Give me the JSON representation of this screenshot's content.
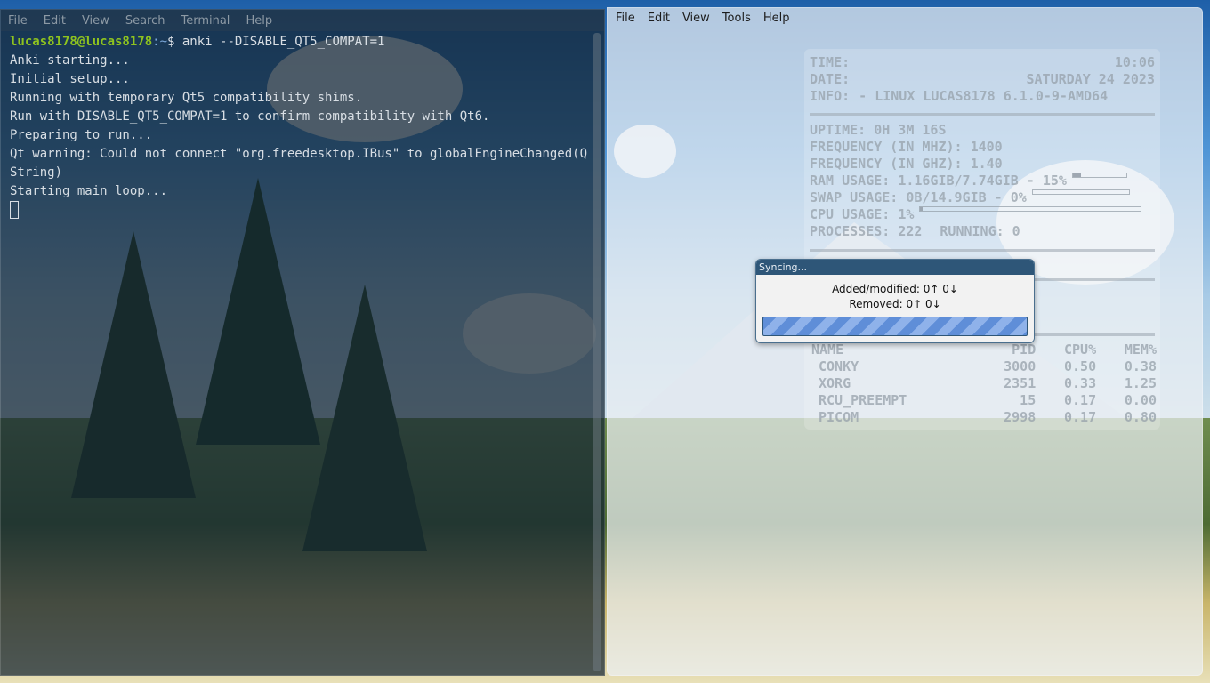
{
  "terminal": {
    "menu": [
      "File",
      "Edit",
      "View",
      "Search",
      "Terminal",
      "Help"
    ],
    "prompt_user": "lucas8178@lucas8178",
    "prompt_path": ":~",
    "prompt_command": "$ anki --DISABLE_QT5_COMPAT=1",
    "output": [
      "Anki starting...",
      "Initial setup...",
      "Running with temporary Qt5 compatibility shims.",
      "Run with DISABLE_QT5_COMPAT=1 to confirm compatibility with Qt6.",
      "Preparing to run...",
      "Qt warning: Could not connect \"org.freedesktop.IBus\" to globalEngineChanged(QString)",
      "Starting main loop..."
    ]
  },
  "anki": {
    "menu": [
      "File",
      "Edit",
      "View",
      "Tools",
      "Help"
    ]
  },
  "conky": {
    "time_label": "TIME:",
    "time_value": "10:06",
    "date_label": "DATE:",
    "date_value": "SATURDAY 24 2023",
    "info_label": "INFO:",
    "info_value": "- LINUX LUCAS8178 6.1.0-9-AMD64",
    "uptime_label": "UPTIME:",
    "uptime_value": "0H 3M 16S",
    "freq_mhz_label": "FREQUENCY (IN MHZ):",
    "freq_mhz_value": "1400",
    "freq_ghz_label": "FREQUENCY (IN GHZ):",
    "freq_ghz_value": "1.40",
    "ram_label": "RAM USAGE:",
    "ram_value": "1.16GIB/7.74GIB - 15%",
    "ram_fraction": 0.15,
    "swap_label": "SWAP USAGE:",
    "swap_value": "0B/14.9GIB - 0%",
    "swap_fraction": 0,
    "cpu_label": "CPU USAGE:",
    "cpu_value": "1%",
    "cpu_fraction": 0.01,
    "processes_label": "PROCESSES:",
    "processes_value": "222",
    "running_label": "RUNNING:",
    "running_value": "0",
    "table_headers": [
      "NAME",
      "PID",
      "CPU%",
      "MEM%"
    ],
    "table_rows": [
      [
        "CONKY",
        "3000",
        "0.50",
        "0.38"
      ],
      [
        "XORG",
        "2351",
        "0.33",
        "1.25"
      ],
      [
        "RCU_PREEMPT",
        "15",
        "0.17",
        "0.00"
      ],
      [
        "PICOM",
        "2998",
        "0.17",
        "0.80"
      ]
    ]
  },
  "sync_dialog": {
    "title": "Syncing...",
    "added_modified": "Added/modified: 0↑ 0↓",
    "removed": "Removed: 0↑ 0↓"
  }
}
